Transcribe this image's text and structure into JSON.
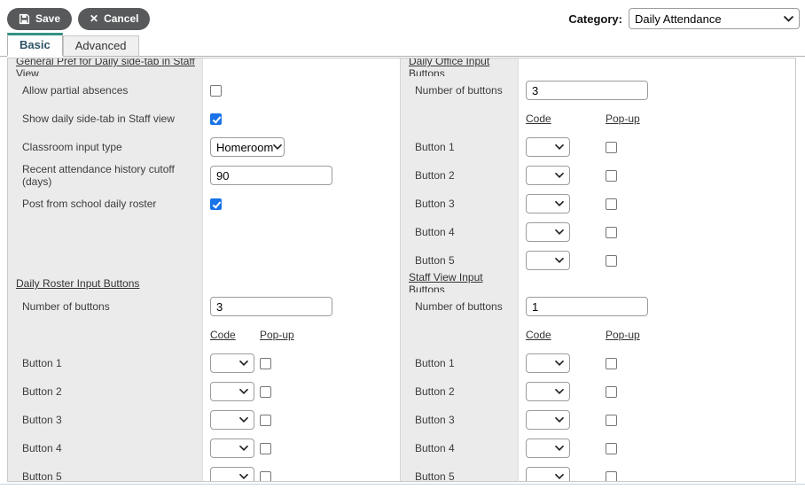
{
  "toolbar": {
    "save": "Save",
    "cancel": "Cancel"
  },
  "category": {
    "label": "Category:",
    "value": "Daily Attendance"
  },
  "tabs": {
    "basic": "Basic",
    "advanced": "Advanced"
  },
  "general": {
    "title": "General Pref for Daily side-tab in Staff View",
    "fields": [
      {
        "label": "Allow partial absences",
        "type": "checkbox",
        "checked": false
      },
      {
        "label": "Show daily side-tab in Staff view",
        "type": "checkbox",
        "checked": true
      },
      {
        "label": "Classroom input type",
        "type": "select",
        "value": "Homeroom"
      },
      {
        "label": "Recent attendance history cutoff (days)",
        "type": "text",
        "value": "90"
      },
      {
        "label": "Post from school daily roster",
        "type": "checkbox",
        "checked": true
      }
    ]
  },
  "daily_roster": {
    "title": "Daily Roster Input Buttons",
    "number_label": "Number of buttons",
    "number_value": "3",
    "code_header": "Code",
    "popup_header": "Pop-up",
    "buttons": [
      "Button 1",
      "Button 2",
      "Button 3",
      "Button 4",
      "Button 5"
    ],
    "button_defaults": {
      "code_value": "",
      "popup_checked": false
    }
  },
  "daily_office": {
    "title": "Daily Office Input Buttons",
    "number_label": "Number of buttons",
    "number_value": "3",
    "code_header": "Code",
    "popup_header": "Pop-up",
    "buttons": [
      "Button 1",
      "Button 2",
      "Button 3",
      "Button 4",
      "Button 5"
    ],
    "button_defaults": {
      "code_value": "",
      "popup_checked": false
    }
  },
  "staff_view": {
    "title": "Staff View Input Buttons",
    "number_label": "Number of buttons",
    "number_value": "1",
    "code_header": "Code",
    "popup_header": "Pop-up",
    "buttons": [
      "Button 1",
      "Button 2",
      "Button 3",
      "Button 4",
      "Button 5"
    ],
    "button_defaults": {
      "code_value": "",
      "popup_checked": false
    }
  },
  "colors": {
    "accent_teal": "#349184",
    "checkbox_blue": "#1a73e8",
    "toolbar_button_gray": "#58595b",
    "label_cell_gray": "#ebebeb"
  }
}
